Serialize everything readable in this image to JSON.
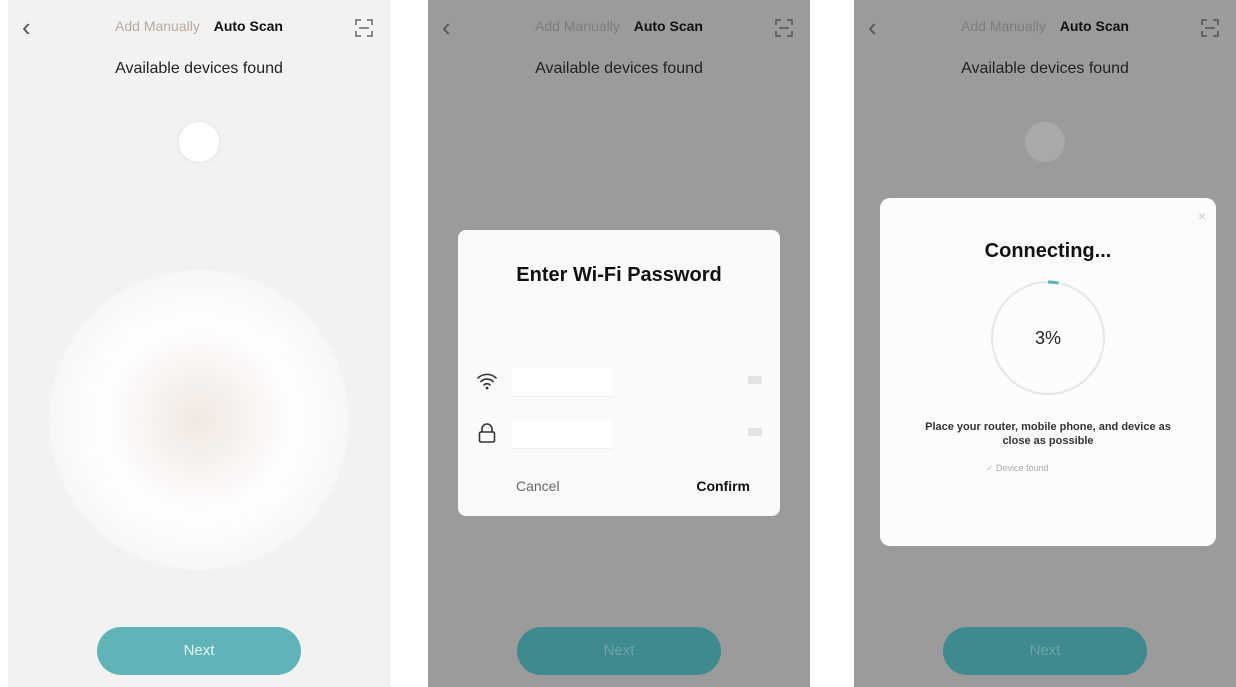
{
  "screens": [
    {
      "back_icon": "chevron-left-icon",
      "tab_manual": "Add Manually",
      "tab_auto": "Auto Scan",
      "scan_icon": "scan-icon",
      "subtitle": "Available devices found",
      "next_label": "Next"
    },
    {
      "back_icon": "chevron-left-icon",
      "tab_manual": "Add Manually",
      "tab_auto": "Auto Scan",
      "scan_icon": "scan-icon",
      "subtitle": "Available devices found",
      "dialog_title": "Enter Wi-Fi Password",
      "wifi_icon": "wifi-icon",
      "lock_icon": "lock-icon",
      "cancel_label": "Cancel",
      "confirm_label": "Confirm",
      "next_label": "Next"
    },
    {
      "back_icon": "chevron-left-icon",
      "tab_manual": "Add Manually",
      "tab_auto": "Auto Scan",
      "scan_icon": "scan-icon",
      "subtitle": "Available devices found",
      "dialog_title": "Connecting...",
      "progress_text": "3%",
      "progress_fraction": 0.03,
      "message": "Place your router, mobile phone, and device as close as possible",
      "step_1": "Device found",
      "next_label": "Next"
    }
  ],
  "colors": {
    "accent_button": "#5fb4b8",
    "overlay_background": "#9b9b9b",
    "progress_ring": "#5fb4b8"
  }
}
